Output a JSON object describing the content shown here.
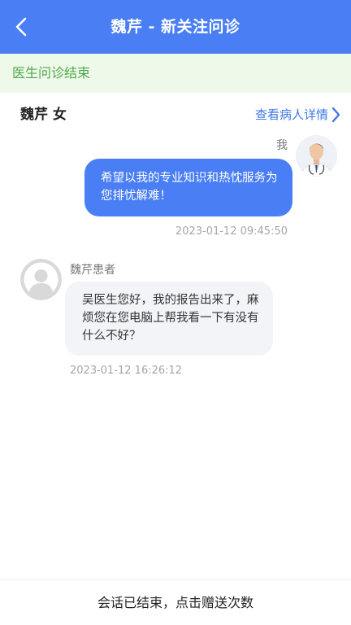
{
  "header": {
    "title": "魏芹 - 新关注问诊",
    "back_icon": "chevron-left-icon"
  },
  "status": {
    "text": "医生问诊结束"
  },
  "patient": {
    "name": "魏芹 女",
    "details_link": "查看病人详情",
    "details_icon": "chevron-right-icon"
  },
  "messages": [
    {
      "sender": "我",
      "text": "希望以我的专业知识和热忱服务为您排忧解难！",
      "time": "2023-01-12 09:45:50",
      "avatar": "doctor-avatar"
    },
    {
      "sender": "魏芹患者",
      "text": "吴医生您好，我的报告出来了，麻烦您在您电脑上帮我看一下有没有什么不好？",
      "time": "2023-01-12 16:26:12",
      "avatar": "default-person-icon"
    }
  ],
  "footer": {
    "button_label": "会话已结束，点击赠送次数"
  },
  "colors": {
    "header_bg": "#4a7ef5",
    "status_bg": "#eef9ea",
    "status_text": "#4fa84a",
    "link": "#3f78e6",
    "sent_bubble": "#4a7ef5",
    "received_bubble": "#f3f4f7"
  }
}
